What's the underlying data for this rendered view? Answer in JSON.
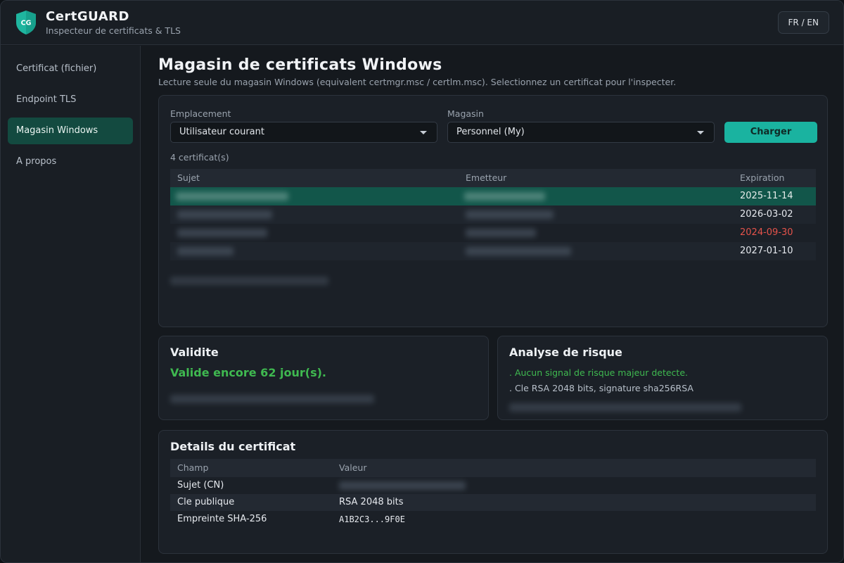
{
  "app": {
    "name": "CertGUARD",
    "subtitle": "Inspecteur de certificats & TLS",
    "logo_initials": "CG",
    "lang_toggle": "FR / EN"
  },
  "sidebar": {
    "items": [
      {
        "label": "Certificat (fichier)"
      },
      {
        "label": "Endpoint TLS"
      },
      {
        "label": "Magasin Windows"
      },
      {
        "label": "A propos"
      }
    ]
  },
  "page": {
    "title": "Magasin de certificats Windows",
    "subtitle": "Lecture seule du magasin Windows (equivalent certmgr.msc / certlm.msc). Selectionnez un certificat pour l'inspecter."
  },
  "store": {
    "location_label": "Emplacement",
    "location_value": "Utilisateur courant",
    "store_label": "Magasin",
    "store_value": "Personnel (My)",
    "load_button": "Charger",
    "count": "4 certificat(s)",
    "columns": {
      "subject": "Sujet",
      "issuer": "Emetteur",
      "expiration": "Expiration"
    },
    "rows": [
      {
        "expiration": "2025-11-14",
        "status": "selected"
      },
      {
        "expiration": "2026-03-02",
        "status": "ok"
      },
      {
        "expiration": "2024-09-30",
        "status": "expired"
      },
      {
        "expiration": "2027-01-10",
        "status": "ok"
      }
    ]
  },
  "validity": {
    "title": "Validite",
    "status_text": "Valide encore 62 jour(s)."
  },
  "risk": {
    "title": "Analyse de risque",
    "lines": [
      ". Aucun signal de risque majeur detecte.",
      ". Cle RSA 2048 bits, signature sha256RSA"
    ]
  },
  "details": {
    "title": "Details du certificat",
    "columns": {
      "field": "Champ",
      "value": "Valeur"
    },
    "rows": [
      {
        "field": "Sujet (CN)",
        "value": ""
      },
      {
        "field": "Cle publique",
        "value": "RSA 2048 bits"
      },
      {
        "field": "Empreinte SHA-256",
        "value": "A1B2C3...9F0E"
      }
    ]
  },
  "colors": {
    "accent": "#1ab3a0",
    "selected_row": "#12564a",
    "ok_green": "#3fb950",
    "expired_red": "#e5534b"
  }
}
